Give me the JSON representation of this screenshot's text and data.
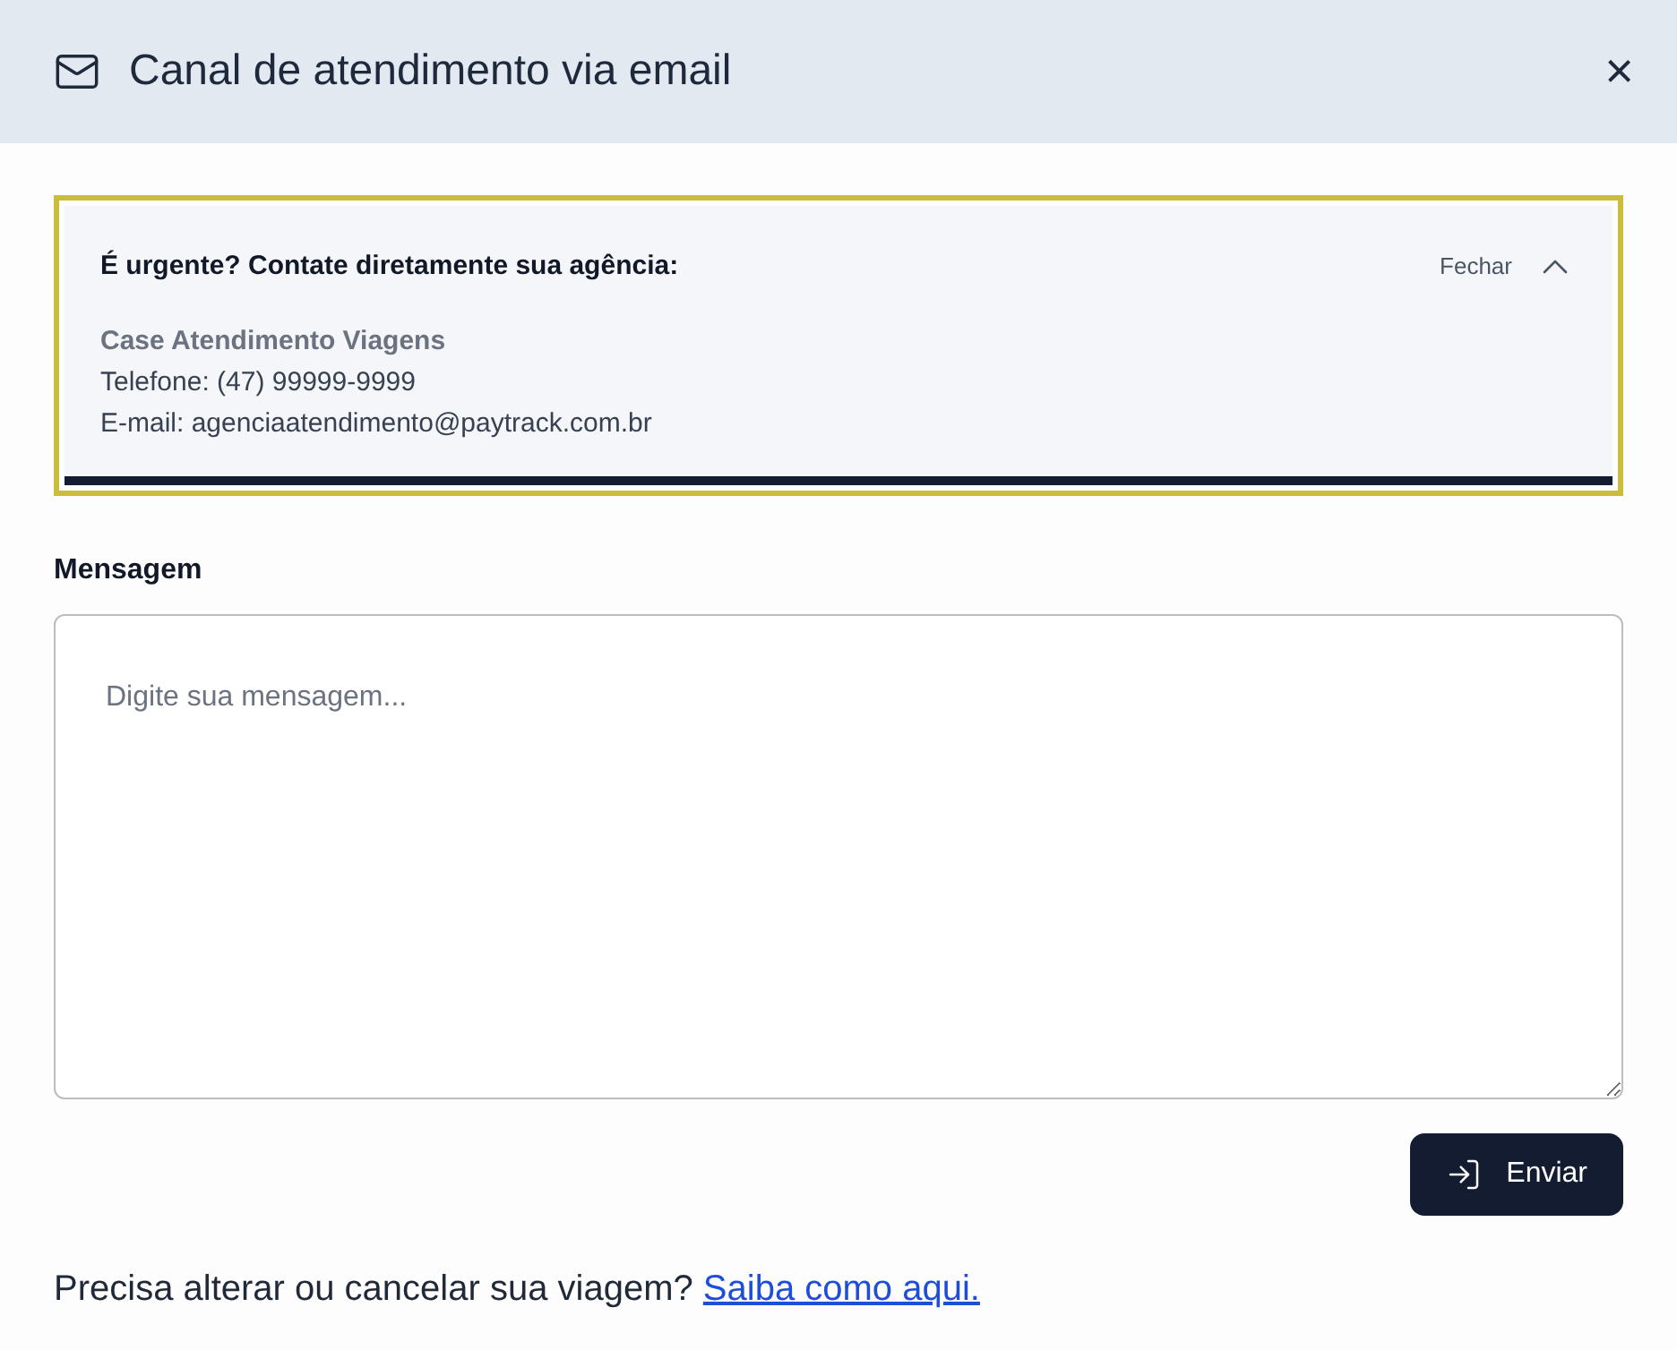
{
  "header": {
    "title": "Canal de atendimento via email",
    "close": "×"
  },
  "alert": {
    "title": "É urgente? Contate diretamente sua agência:",
    "toggle": "Fechar",
    "expanded": true,
    "focused": true,
    "agency": "Case Atendimento Viagens",
    "phone": "Telefone: (47) 99999-9999",
    "email": "E-mail: agenciaatendimento@paytrack.com.br"
  },
  "message": {
    "label": "Mensagem",
    "placeholder": "Digite sua mensagem..."
  },
  "send_button": "Enviar",
  "footer": {
    "text": "Precisa alterar ou cancelar sua viagem?",
    "link": "Saiba como aqui."
  }
}
